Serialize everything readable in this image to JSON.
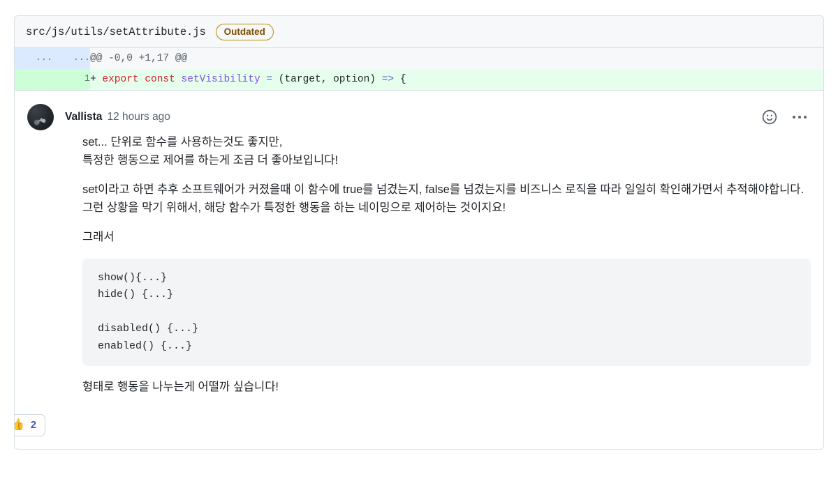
{
  "file": {
    "path": "src/js/utils/setAttribute.js",
    "status_badge": "Outdated"
  },
  "diff": {
    "hunk": {
      "old_gutter": "...",
      "new_gutter": "...",
      "header": "@@ -0,0 +1,17 @@"
    },
    "added_line": {
      "line_number": "1",
      "marker": "+",
      "tokens": [
        {
          "text": "export",
          "type": "keyword"
        },
        {
          "text": "const",
          "type": "keyword"
        },
        {
          "text": "setVisibility",
          "type": "function"
        },
        {
          "text": "=",
          "type": "operator"
        },
        {
          "text": "(target, option)",
          "type": "plain"
        },
        {
          "text": "=>",
          "type": "operator"
        },
        {
          "text": "{",
          "type": "plain"
        }
      ],
      "full_text": "+ export const setVisibility = (target, option) => {"
    }
  },
  "comment": {
    "author": "Vallista",
    "timestamp": "12 hours ago",
    "reaction_icon": "smiley-face-icon",
    "menu_icon": "kebab-menu-icon",
    "paragraphs": [
      "set... 단위로 함수를 사용하는것도 좋지만,\n특정한 행동으로 제어를 하는게 조금 더 좋아보입니다!",
      "set이라고 하면 추후 소프트웨어가 커졌을때 이 함수에 true를 넘겼는지, false를 넘겼는지를 비즈니스 로직을 따라 일일히 확인해가면서 추적해야합니다. 그런 상황을 막기 위해서, 해당 함수가 특정한 행동을 하는 네이밍으로 제어하는 것이지요!",
      "그래서"
    ],
    "code_block": "show(){...}\nhide() {...}\n\ndisabled() {...}\nenabled() {...}",
    "closing_paragraph": "형태로 행동을 나누는게 어떨까 싶습니다!",
    "reactions": [
      {
        "emoji": "👍",
        "name": "thumbs-up",
        "count": "2"
      }
    ]
  },
  "colors": {
    "added_bg": "#e6ffec",
    "added_gutter": "#ccffd8",
    "hunk_gutter": "#dbeafe",
    "badge_border": "#bc8c00",
    "badge_text": "#7d4e00",
    "keyword": "#cf222e",
    "function": "#8250df",
    "operator": "#5b5bd6",
    "reaction_count": "#4a53bd"
  }
}
